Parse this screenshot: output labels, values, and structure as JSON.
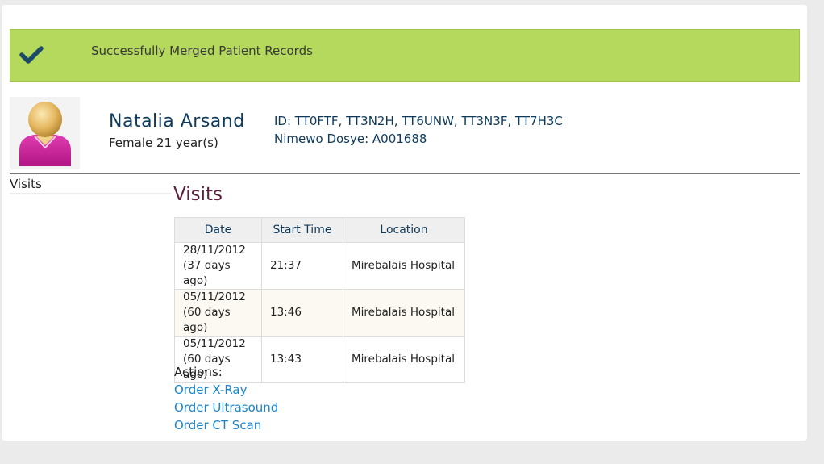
{
  "flash": {
    "message": "Successfully Merged Patient Records",
    "icon": "checkmark-icon",
    "color": "#b5d95c"
  },
  "patient": {
    "name": "Natalia Arsand",
    "demographics": "Female 21 year(s)",
    "ids": "ID: TT0FTF, TT3N2H, TT6UNW, TT3N3F, TT7H3C",
    "dossier": "Nimewo Dosye: A001688",
    "avatar_icon": "female-patient-avatar-icon"
  },
  "sidebar": {
    "label": "Visits"
  },
  "visits": {
    "title": "Visits",
    "headers": {
      "date": "Date",
      "start_time": "Start Time",
      "location": "Location"
    },
    "rows": [
      {
        "date": "28/11/2012",
        "ago": "(37 days ago)",
        "start_time": "21:37",
        "location": "Mirebalais Hospital"
      },
      {
        "date": "05/11/2012",
        "ago": "(60 days ago)",
        "start_time": "13:46",
        "location": "Mirebalais Hospital"
      },
      {
        "date": "05/11/2012",
        "ago": "(60 days ago)",
        "start_time": "13:43",
        "location": "Mirebalais Hospital"
      }
    ]
  },
  "actions": {
    "label": "Actions:",
    "links": [
      "Order X-Ray",
      "Order Ultrasound",
      "Order CT Scan"
    ]
  }
}
